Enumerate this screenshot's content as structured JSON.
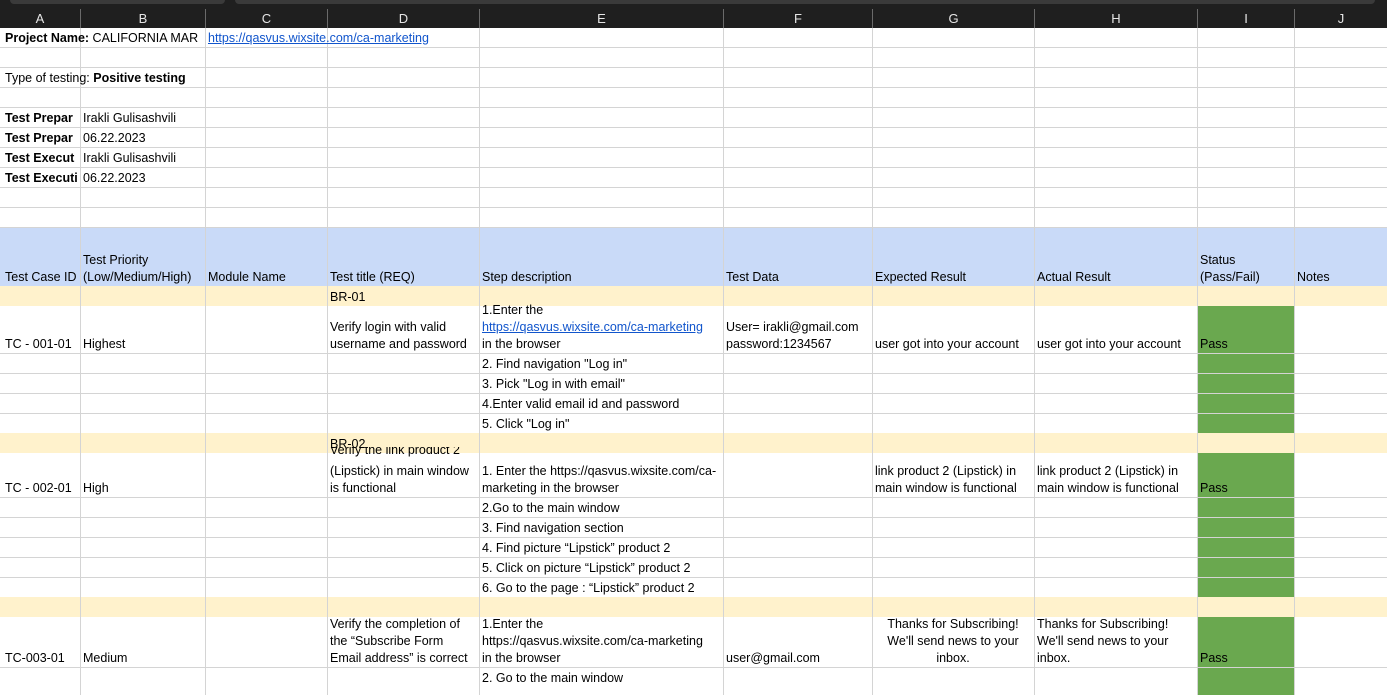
{
  "columns": [
    "A",
    "B",
    "C",
    "D",
    "E",
    "F",
    "G",
    "H",
    "I",
    "J"
  ],
  "meta": {
    "project_label": "Project Name:",
    "project_value": "CALIFORNIA MAR",
    "project_link": "https://qasvus.wixsite.com/ca-marketing",
    "testing_label": "Type of testing:",
    "testing_value": "Positive testing",
    "prep_by_label": "Test Prepar",
    "prep_by_value": "Irakli Gulisashvili",
    "prep_date_label": "Test Prepar",
    "prep_date_value": "06.22.2023",
    "exec_by_label": "Test Execut",
    "exec_by_value": "Irakli Gulisashvili",
    "exec_date_label": "Test Executi",
    "exec_date_value": "06.22.2023"
  },
  "header": {
    "test_case_id": "Test Case ID",
    "priority_line1": "Test Priority",
    "priority_line2": "(Low/Medium/High)",
    "module": "Module Name",
    "title": "Test title (REQ)",
    "steps": "Step description",
    "data": "Test Data",
    "expected": "Expected Result",
    "actual": "Actual Result",
    "status_line1": "Status",
    "status_line2": "(Pass/Fail)",
    "notes": "Notes"
  },
  "br01": "BR-01",
  "br02": "BR-02",
  "tc1": {
    "id": "TC - 001-01",
    "priority": "Highest",
    "title": "Verify login with valid username and password",
    "step1_a": "1.Enter the",
    "step1_link": "https://qasvus.wixsite.com/ca-marketing",
    "step1_b": "in the browser",
    "step2": "2. Find navigation \"Log in\"",
    "step3": "3. Pick \"Log in with email\"",
    "step4": "4.Enter valid email id and password",
    "step5": "5. Click \"Log in\"",
    "data_line1": "User= irakli@gmail.com",
    "data_line2": "password:1234567",
    "expected": "user got into your account",
    "actual": "user got into your account",
    "status": "Pass"
  },
  "tc2": {
    "id": "TC - 002-01",
    "priority": "High",
    "title_line1": "Verify the  link product 2",
    "title_line2": "(Lipstick) in main window",
    "title_line3": "is functional",
    "step1_a": "1. Enter the https://qasvus.wixsite.com/ca-",
    "step1_b": "marketing in the browser",
    "step2": "2.Go to the main window",
    "step3": "3. Find navigation section",
    "step4": "4. Find picture  “Lipstick”  product  2",
    "step5": "5. Click on picture “Lipstick” product  2",
    "step6": "6. Go to the  page : “Lipstick”  product  2",
    "expected_line1": "link product 2 (Lipstick) in",
    "expected_line2": "main window  is functional",
    "actual_line1": "link product 2 (Lipstick) in",
    "actual_line2": "main window  is functional",
    "status": "Pass"
  },
  "tc3": {
    "id": "TC-003-01",
    "priority": "Medium",
    "title_line1": "Verify the completion of",
    "title_line2": "the  “Subscribe Form",
    "title_line3": "Email address” is correct",
    "step1_a": "1.Enter the",
    "step1_b": "https://qasvus.wixsite.com/ca-marketing",
    "step1_c": "in the browser",
    "step2": "2. Go to the main window",
    "data": "user@gmail.com",
    "expected_line1": "Thanks for Subscribing!",
    "expected_line2": "We'll send news to your",
    "expected_line3": "inbox.",
    "actual_line1": "Thanks for Subscribing!",
    "actual_line2": "We'll send news to your",
    "actual_line3": "inbox.",
    "status": "Pass"
  },
  "colors": {
    "header_band": "#c9daf8",
    "br_band": "#fff2cc",
    "pass": "#6aa84f",
    "link": "#1155cc"
  }
}
